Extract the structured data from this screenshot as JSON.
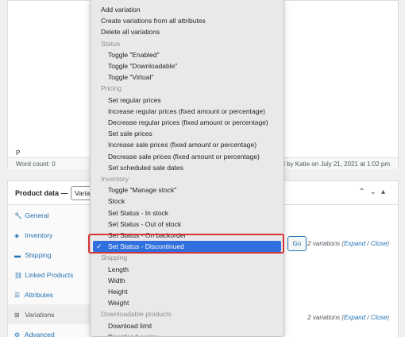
{
  "editor": {
    "path": "P",
    "word_count": "Word count: 0",
    "last_edited": "ted by Katie on July 21, 2021 at 1:02 pm"
  },
  "product_data": {
    "title": "Product data —",
    "select_value": "Varia",
    "go_label": "Go",
    "variations_count_text": "2 variations",
    "expand_label": "Expand",
    "close_label": "Close",
    "tabs": [
      {
        "icon": "wrench-icon",
        "glyph": "🔧",
        "label": "General"
      },
      {
        "icon": "stock-icon",
        "glyph": "◈",
        "label": "Inventory"
      },
      {
        "icon": "truck-icon",
        "glyph": "▬",
        "label": "Shipping"
      },
      {
        "icon": "link-icon",
        "glyph": "⛓",
        "label": "Linked Products"
      },
      {
        "icon": "list-icon",
        "glyph": "☰",
        "label": "Attributes"
      },
      {
        "icon": "grid-icon",
        "glyph": "⊞",
        "label": "Variations"
      },
      {
        "icon": "gear-icon",
        "glyph": "⚙",
        "label": "Advanced"
      }
    ]
  },
  "menu": {
    "items": [
      {
        "type": "top",
        "label": "Add variation"
      },
      {
        "type": "top",
        "label": "Create variations from all attributes"
      },
      {
        "type": "top",
        "label": "Delete all variations"
      },
      {
        "type": "group",
        "label": "Status"
      },
      {
        "type": "item",
        "label": "Toggle \"Enabled\""
      },
      {
        "type": "item",
        "label": "Toggle \"Downloadable\""
      },
      {
        "type": "item",
        "label": "Toggle \"Virtual\""
      },
      {
        "type": "group",
        "label": "Pricing"
      },
      {
        "type": "item",
        "label": "Set regular prices"
      },
      {
        "type": "item",
        "label": "Increase regular prices (fixed amount or percentage)"
      },
      {
        "type": "item",
        "label": "Decrease regular prices (fixed amount or percentage)"
      },
      {
        "type": "item",
        "label": "Set sale prices"
      },
      {
        "type": "item",
        "label": "Increase sale prices (fixed amount or percentage)"
      },
      {
        "type": "item",
        "label": "Decrease sale prices (fixed amount or percentage)"
      },
      {
        "type": "item",
        "label": "Set scheduled sale dates"
      },
      {
        "type": "group",
        "label": "Inventory"
      },
      {
        "type": "item",
        "label": "Toggle \"Manage stock\""
      },
      {
        "type": "item",
        "label": "Stock"
      },
      {
        "type": "item",
        "label": "Set Status - In stock"
      },
      {
        "type": "item",
        "label": "Set Status - Out of stock"
      },
      {
        "type": "item",
        "label": "Set Status - On backorder"
      },
      {
        "type": "selected",
        "label": "Set Status - Discontinued"
      },
      {
        "type": "group",
        "label": "Shipping"
      },
      {
        "type": "item",
        "label": "Length"
      },
      {
        "type": "item",
        "label": "Width"
      },
      {
        "type": "item",
        "label": "Height"
      },
      {
        "type": "item",
        "label": "Weight"
      },
      {
        "type": "group",
        "label": "Downloadable products"
      },
      {
        "type": "item",
        "label": "Download limit"
      },
      {
        "type": "item",
        "label": "Download expiry"
      }
    ],
    "check_glyph": "✓"
  },
  "colors": {
    "selected_bg": "#2f6fde",
    "highlight_border": "#d63638",
    "link": "#2271b1"
  }
}
